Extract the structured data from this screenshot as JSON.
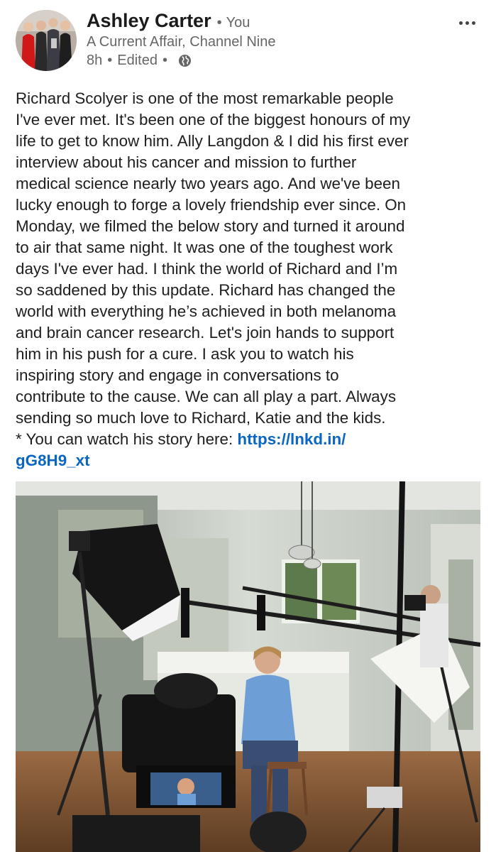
{
  "author": {
    "name": "Ashley Carter",
    "separator": "•",
    "relation": "You",
    "headline": "A Current Affair, Channel Nine",
    "time": "8h",
    "edited": "Edited",
    "visibility_icon": "globe-icon"
  },
  "post": {
    "lines": [
      "Richard Scolyer is one of the most remarkable people",
      "I've ever met. It's been one of the biggest honours of my",
      "life to get to know him. Ally Langdon & I did his first ever",
      "interview about his cancer and mission to further",
      "medical science nearly two years ago. And we've been",
      "lucky enough to forge a lovely friendship ever since. On",
      "Monday, we filmed the below story and turned it around",
      "to air that same night. It was one of the toughest work",
      "days I've ever had. I think the world of Richard and I’m",
      "so saddened by this update. Richard has changed the",
      "world with everything he’s achieved in both melanoma",
      "and brain cancer research. Let's join hands to support",
      "him in his push for a cure. I ask you to watch his",
      "inspiring story and engage in conversations to",
      "contribute to the cause. We can all play a part. Always",
      "sending so much love to Richard, Katie and the kids."
    ],
    "link_prefix": "* You can watch his story here: ",
    "link_part1": "https://lnkd.in/",
    "link_part2": "gG8H9_xt"
  },
  "icons": {
    "more": "more-options-icon",
    "visibility": "globe-icon"
  },
  "colors": {
    "link": "#0a66c2",
    "secondary_text": "#666666",
    "primary_text": "#1e1e1e"
  }
}
